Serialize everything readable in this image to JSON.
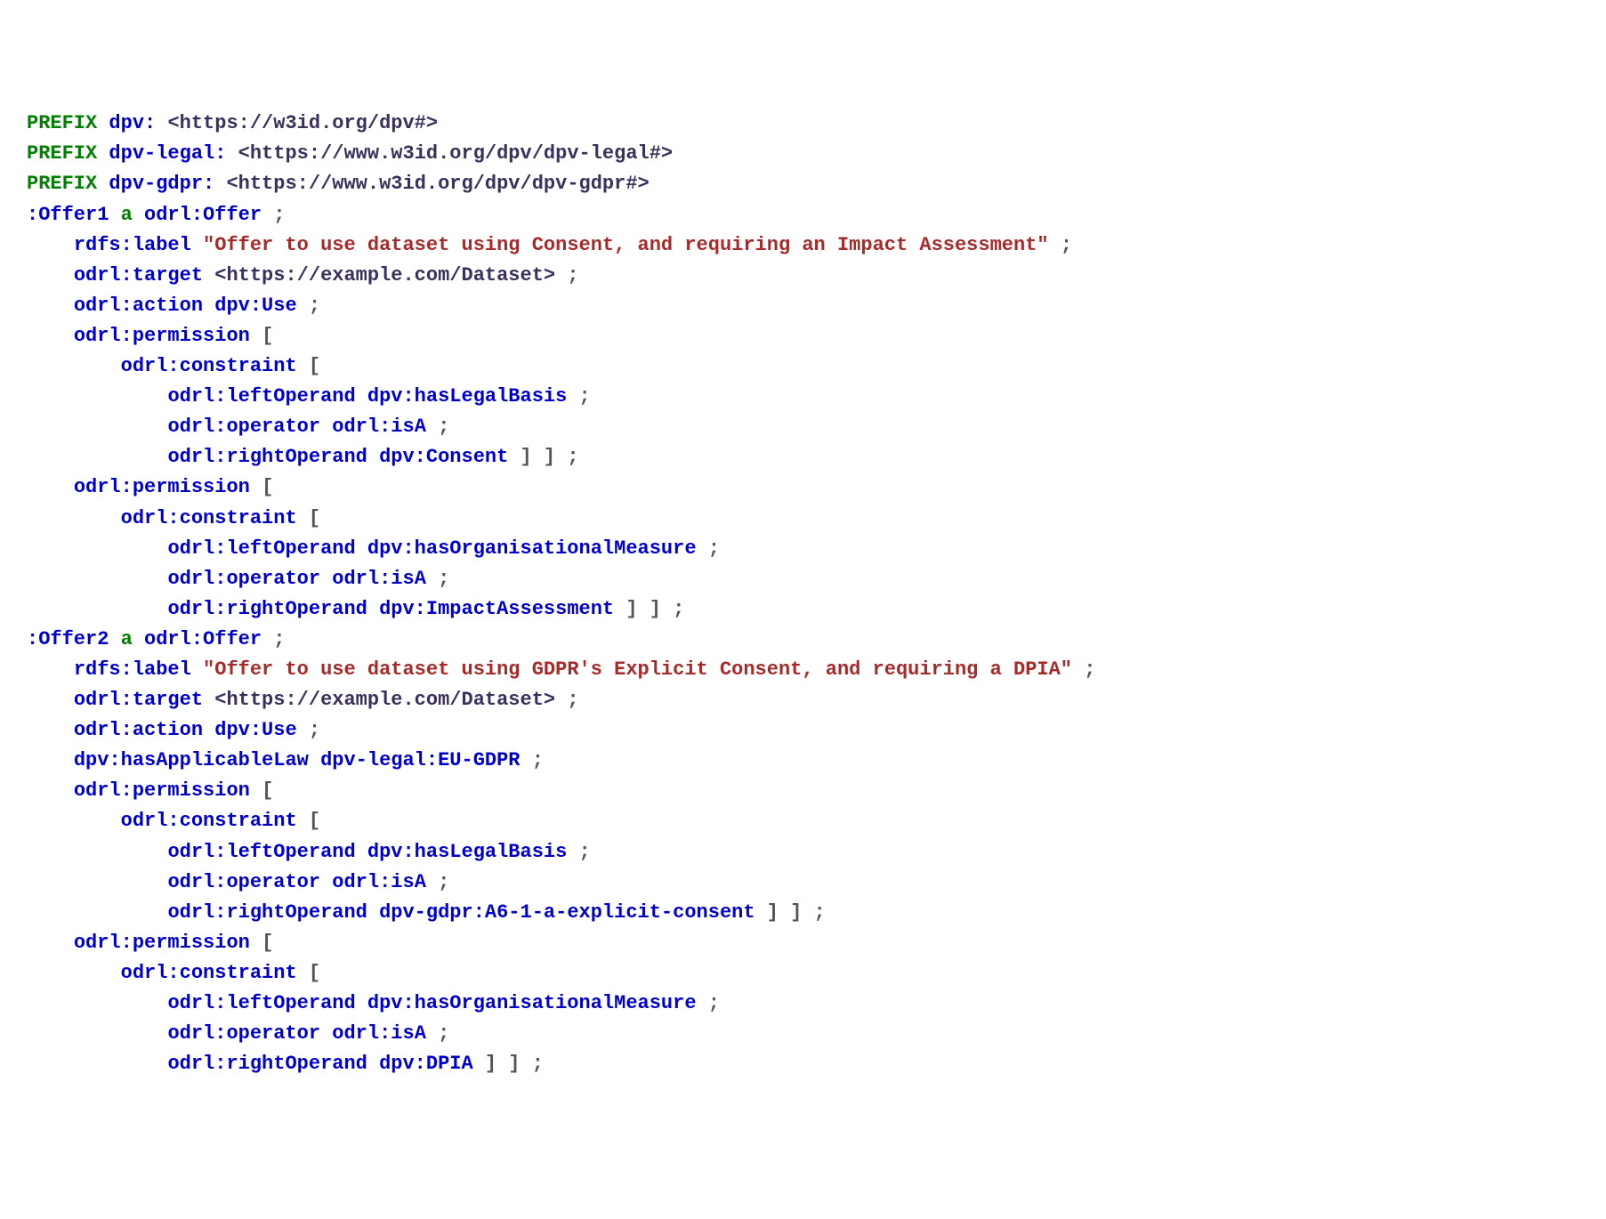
{
  "lines": [
    [
      {
        "cls": "kw",
        "t": "PREFIX "
      },
      {
        "cls": "pfx",
        "t": "dpv:"
      },
      {
        "cls": "nc",
        "t": " "
      },
      {
        "cls": "uri",
        "t": "<https://w3id.org/dpv#>"
      }
    ],
    [
      {
        "cls": "kw",
        "t": "PREFIX "
      },
      {
        "cls": "pfx",
        "t": "dpv-legal:"
      },
      {
        "cls": "nc",
        "t": " "
      },
      {
        "cls": "uri",
        "t": "<https://www.w3id.org/dpv/dpv-legal#>"
      }
    ],
    [
      {
        "cls": "kw",
        "t": "PREFIX "
      },
      {
        "cls": "pfx",
        "t": "dpv-gdpr:"
      },
      {
        "cls": "nc",
        "t": " "
      },
      {
        "cls": "uri",
        "t": "<https://www.w3id.org/dpv/dpv-gdpr#>"
      }
    ],
    [
      {
        "cls": "pfx",
        "t": ":Offer1"
      },
      {
        "cls": "nc",
        "t": " "
      },
      {
        "cls": "kw",
        "t": "a"
      },
      {
        "cls": "nc",
        "t": " "
      },
      {
        "cls": "pfx",
        "t": "odrl:Offer"
      },
      {
        "cls": "nc",
        "t": " "
      },
      {
        "cls": "punct",
        "t": ";"
      }
    ],
    [
      {
        "cls": "nc",
        "t": "    "
      },
      {
        "cls": "pfx",
        "t": "rdfs:label"
      },
      {
        "cls": "nc",
        "t": " "
      },
      {
        "cls": "str",
        "t": "\"Offer to use dataset using Consent, and requiring an Impact Assessment\""
      },
      {
        "cls": "nc",
        "t": " "
      },
      {
        "cls": "punct",
        "t": ";"
      }
    ],
    [
      {
        "cls": "nc",
        "t": "    "
      },
      {
        "cls": "pfx",
        "t": "odrl:target"
      },
      {
        "cls": "nc",
        "t": " "
      },
      {
        "cls": "uri",
        "t": "<https://example.com/Dataset>"
      },
      {
        "cls": "nc",
        "t": " "
      },
      {
        "cls": "punct",
        "t": ";"
      }
    ],
    [
      {
        "cls": "nc",
        "t": "    "
      },
      {
        "cls": "pfx",
        "t": "odrl:action"
      },
      {
        "cls": "nc",
        "t": " "
      },
      {
        "cls": "pfx",
        "t": "dpv:Use"
      },
      {
        "cls": "nc",
        "t": " "
      },
      {
        "cls": "punct",
        "t": ";"
      }
    ],
    [
      {
        "cls": "nc",
        "t": "    "
      },
      {
        "cls": "pfx",
        "t": "odrl:permission"
      },
      {
        "cls": "nc",
        "t": " "
      },
      {
        "cls": "punct",
        "t": "["
      }
    ],
    [
      {
        "cls": "nc",
        "t": "        "
      },
      {
        "cls": "pfx",
        "t": "odrl:constraint"
      },
      {
        "cls": "nc",
        "t": " "
      },
      {
        "cls": "punct",
        "t": "["
      }
    ],
    [
      {
        "cls": "nc",
        "t": "            "
      },
      {
        "cls": "pfx",
        "t": "odrl:leftOperand"
      },
      {
        "cls": "nc",
        "t": " "
      },
      {
        "cls": "pfx",
        "t": "dpv:hasLegalBasis"
      },
      {
        "cls": "nc",
        "t": " "
      },
      {
        "cls": "punct",
        "t": ";"
      }
    ],
    [
      {
        "cls": "nc",
        "t": "            "
      },
      {
        "cls": "pfx",
        "t": "odrl:operator"
      },
      {
        "cls": "nc",
        "t": " "
      },
      {
        "cls": "pfx",
        "t": "odrl:isA"
      },
      {
        "cls": "nc",
        "t": " "
      },
      {
        "cls": "punct",
        "t": ";"
      }
    ],
    [
      {
        "cls": "nc",
        "t": "            "
      },
      {
        "cls": "pfx",
        "t": "odrl:rightOperand"
      },
      {
        "cls": "nc",
        "t": " "
      },
      {
        "cls": "pfx",
        "t": "dpv:Consent"
      },
      {
        "cls": "nc",
        "t": " "
      },
      {
        "cls": "punct",
        "t": "] ] ;"
      }
    ],
    [
      {
        "cls": "nc",
        "t": "    "
      },
      {
        "cls": "pfx",
        "t": "odrl:permission"
      },
      {
        "cls": "nc",
        "t": " "
      },
      {
        "cls": "punct",
        "t": "["
      }
    ],
    [
      {
        "cls": "nc",
        "t": "        "
      },
      {
        "cls": "pfx",
        "t": "odrl:constraint"
      },
      {
        "cls": "nc",
        "t": " "
      },
      {
        "cls": "punct",
        "t": "["
      }
    ],
    [
      {
        "cls": "nc",
        "t": "            "
      },
      {
        "cls": "pfx",
        "t": "odrl:leftOperand"
      },
      {
        "cls": "nc",
        "t": " "
      },
      {
        "cls": "pfx",
        "t": "dpv:hasOrganisationalMeasure"
      },
      {
        "cls": "nc",
        "t": " "
      },
      {
        "cls": "punct",
        "t": ";"
      }
    ],
    [
      {
        "cls": "nc",
        "t": "            "
      },
      {
        "cls": "pfx",
        "t": "odrl:operator"
      },
      {
        "cls": "nc",
        "t": " "
      },
      {
        "cls": "pfx",
        "t": "odrl:isA"
      },
      {
        "cls": "nc",
        "t": " "
      },
      {
        "cls": "punct",
        "t": ";"
      }
    ],
    [
      {
        "cls": "nc",
        "t": "            "
      },
      {
        "cls": "pfx",
        "t": "odrl:rightOperand"
      },
      {
        "cls": "nc",
        "t": " "
      },
      {
        "cls": "pfx",
        "t": "dpv:ImpactAssessment"
      },
      {
        "cls": "nc",
        "t": " "
      },
      {
        "cls": "punct",
        "t": "] ] ;"
      }
    ],
    [
      {
        "cls": "pfx",
        "t": ":Offer2"
      },
      {
        "cls": "nc",
        "t": " "
      },
      {
        "cls": "kw",
        "t": "a"
      },
      {
        "cls": "nc",
        "t": " "
      },
      {
        "cls": "pfx",
        "t": "odrl:Offer"
      },
      {
        "cls": "nc",
        "t": " "
      },
      {
        "cls": "punct",
        "t": ";"
      }
    ],
    [
      {
        "cls": "nc",
        "t": "    "
      },
      {
        "cls": "pfx",
        "t": "rdfs:label"
      },
      {
        "cls": "nc",
        "t": " "
      },
      {
        "cls": "str",
        "t": "\"Offer to use dataset using GDPR's Explicit Consent, and requiring a DPIA\""
      },
      {
        "cls": "nc",
        "t": " "
      },
      {
        "cls": "punct",
        "t": ";"
      }
    ],
    [
      {
        "cls": "nc",
        "t": "    "
      },
      {
        "cls": "pfx",
        "t": "odrl:target"
      },
      {
        "cls": "nc",
        "t": " "
      },
      {
        "cls": "uri",
        "t": "<https://example.com/Dataset>"
      },
      {
        "cls": "nc",
        "t": " "
      },
      {
        "cls": "punct",
        "t": ";"
      }
    ],
    [
      {
        "cls": "nc",
        "t": "    "
      },
      {
        "cls": "pfx",
        "t": "odrl:action"
      },
      {
        "cls": "nc",
        "t": " "
      },
      {
        "cls": "pfx",
        "t": "dpv:Use"
      },
      {
        "cls": "nc",
        "t": " "
      },
      {
        "cls": "punct",
        "t": ";"
      }
    ],
    [
      {
        "cls": "nc",
        "t": "    "
      },
      {
        "cls": "pfx",
        "t": "dpv:hasApplicableLaw"
      },
      {
        "cls": "nc",
        "t": " "
      },
      {
        "cls": "pfx",
        "t": "dpv-legal:EU-GDPR"
      },
      {
        "cls": "nc",
        "t": " "
      },
      {
        "cls": "punct",
        "t": ";"
      }
    ],
    [
      {
        "cls": "nc",
        "t": "    "
      },
      {
        "cls": "pfx",
        "t": "odrl:permission"
      },
      {
        "cls": "nc",
        "t": " "
      },
      {
        "cls": "punct",
        "t": "["
      }
    ],
    [
      {
        "cls": "nc",
        "t": "        "
      },
      {
        "cls": "pfx",
        "t": "odrl:constraint"
      },
      {
        "cls": "nc",
        "t": " "
      },
      {
        "cls": "punct",
        "t": "["
      }
    ],
    [
      {
        "cls": "nc",
        "t": "            "
      },
      {
        "cls": "pfx",
        "t": "odrl:leftOperand"
      },
      {
        "cls": "nc",
        "t": " "
      },
      {
        "cls": "pfx",
        "t": "dpv:hasLegalBasis"
      },
      {
        "cls": "nc",
        "t": " "
      },
      {
        "cls": "punct",
        "t": ";"
      }
    ],
    [
      {
        "cls": "nc",
        "t": "            "
      },
      {
        "cls": "pfx",
        "t": "odrl:operator"
      },
      {
        "cls": "nc",
        "t": " "
      },
      {
        "cls": "pfx",
        "t": "odrl:isA"
      },
      {
        "cls": "nc",
        "t": " "
      },
      {
        "cls": "punct",
        "t": ";"
      }
    ],
    [
      {
        "cls": "nc",
        "t": "            "
      },
      {
        "cls": "pfx",
        "t": "odrl:rightOperand"
      },
      {
        "cls": "nc",
        "t": " "
      },
      {
        "cls": "pfx",
        "t": "dpv-gdpr:A6-1-a-explicit-consent"
      },
      {
        "cls": "nc",
        "t": " "
      },
      {
        "cls": "punct",
        "t": "] ] ;"
      }
    ],
    [
      {
        "cls": "nc",
        "t": "    "
      },
      {
        "cls": "pfx",
        "t": "odrl:permission"
      },
      {
        "cls": "nc",
        "t": " "
      },
      {
        "cls": "punct",
        "t": "["
      }
    ],
    [
      {
        "cls": "nc",
        "t": "        "
      },
      {
        "cls": "pfx",
        "t": "odrl:constraint"
      },
      {
        "cls": "nc",
        "t": " "
      },
      {
        "cls": "punct",
        "t": "["
      }
    ],
    [
      {
        "cls": "nc",
        "t": "            "
      },
      {
        "cls": "pfx",
        "t": "odrl:leftOperand"
      },
      {
        "cls": "nc",
        "t": " "
      },
      {
        "cls": "pfx",
        "t": "dpv:hasOrganisationalMeasure"
      },
      {
        "cls": "nc",
        "t": " "
      },
      {
        "cls": "punct",
        "t": ";"
      }
    ],
    [
      {
        "cls": "nc",
        "t": "            "
      },
      {
        "cls": "pfx",
        "t": "odrl:operator"
      },
      {
        "cls": "nc",
        "t": " "
      },
      {
        "cls": "pfx",
        "t": "odrl:isA"
      },
      {
        "cls": "nc",
        "t": " "
      },
      {
        "cls": "punct",
        "t": ";"
      }
    ],
    [
      {
        "cls": "nc",
        "t": "            "
      },
      {
        "cls": "pfx",
        "t": "odrl:rightOperand"
      },
      {
        "cls": "nc",
        "t": " "
      },
      {
        "cls": "pfx",
        "t": "dpv:DPIA"
      },
      {
        "cls": "nc",
        "t": " "
      },
      {
        "cls": "punct",
        "t": "] ] ;"
      }
    ]
  ]
}
